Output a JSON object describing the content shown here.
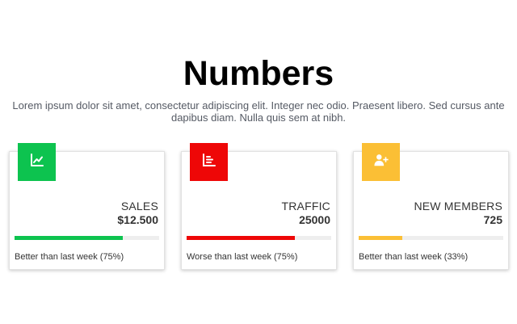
{
  "page": {
    "title": "Numbers",
    "subtitle": "Lorem ipsum dolor sit amet, consectetur adipiscing elit. Integer nec odio. Praesent libero. Sed cursus ante dapibus diam. Nulla quis sem at nibh."
  },
  "cards": [
    {
      "label": "SALES",
      "value": "$12.500",
      "note": "Better than last week (75%)",
      "progress": 0.75,
      "color": "#0dc34f",
      "icon": "chart-line-icon"
    },
    {
      "label": "TRAFFIC",
      "value": "25000",
      "note": "Worse than last week (75%)",
      "progress": 0.75,
      "color": "#ee0707",
      "icon": "bar-list-icon"
    },
    {
      "label": "NEW MEMBERS",
      "value": "725",
      "note": "Better than last week (33%)",
      "progress": 0.3,
      "color": "#fbbf35",
      "icon": "user-plus-icon"
    }
  ]
}
